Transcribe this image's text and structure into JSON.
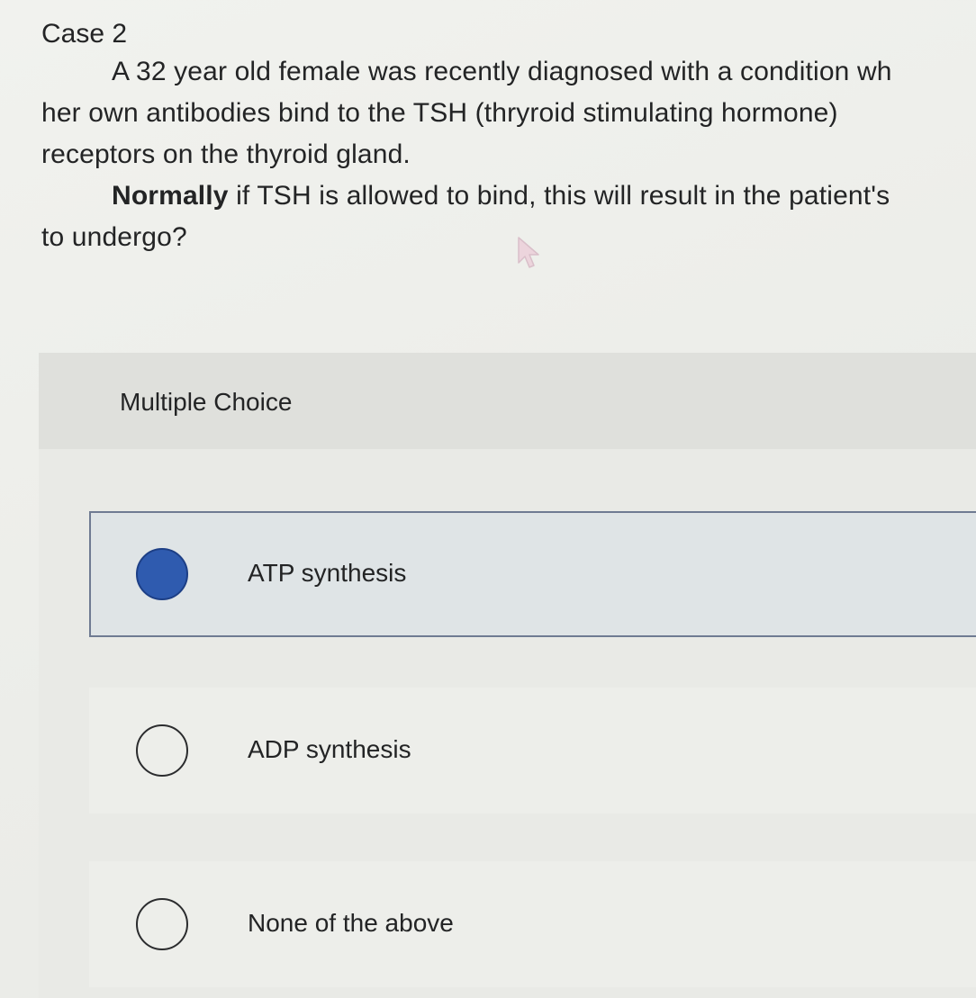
{
  "case": {
    "title": "Case 2"
  },
  "question": {
    "line1": "A 32 year old female was recently diagnosed with a condition wh",
    "line2": "her own antibodies bind to the TSH (thryroid stimulating hormone)",
    "line3": "receptors on the thyroid gland.",
    "line4_bold": "Normally",
    "line4_rest": " if TSH is allowed to bind, this will result in the patient's",
    "line5": "to undergo?"
  },
  "multiple_choice": {
    "header": "Multiple Choice",
    "options": [
      {
        "label": "ATP synthesis",
        "selected": true
      },
      {
        "label": "ADP synthesis",
        "selected": false
      },
      {
        "label": "None of the above",
        "selected": false
      }
    ]
  },
  "colors": {
    "selected_radio": "#2f5baf",
    "selected_border": "#6f7b92",
    "selected_background": "#dfe4e6",
    "header_background": "#dfe0dc"
  },
  "icons": {
    "cursor": "mouse-pointer-icon"
  }
}
